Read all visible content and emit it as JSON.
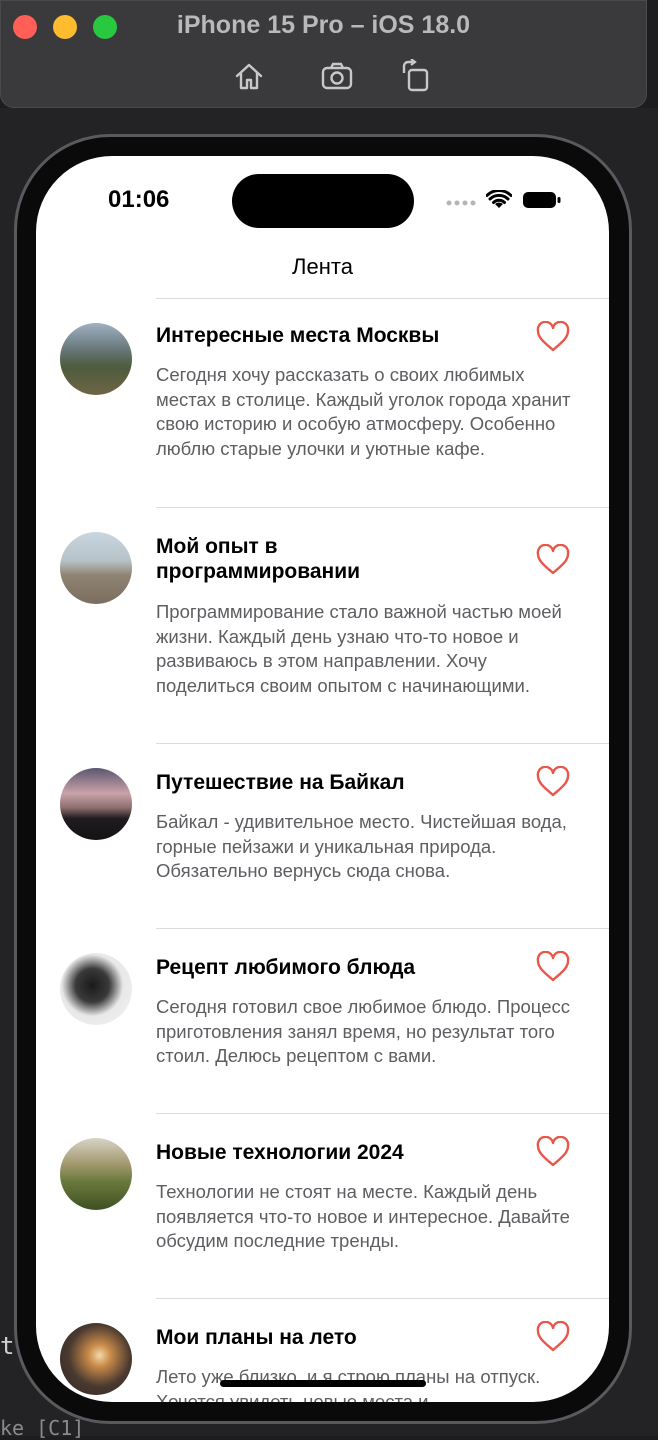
{
  "window": {
    "title": "iPhone 15 Pro – iOS 18.0"
  },
  "toolbar": {
    "icons": [
      "home-icon",
      "screenshot-icon",
      "rotate-icon"
    ]
  },
  "editor": {
    "left_text": "t",
    "bottom_text": "ke [C1]"
  },
  "status_bar": {
    "time": "01:06"
  },
  "nav": {
    "title": "Лента"
  },
  "colors": {
    "heart": "#e8574a",
    "body_text": "#5e5e62"
  },
  "posts": [
    {
      "title": "Интересные места Москвы",
      "body": "Сегодня хочу рассказать о своих любимых местах в столице. Каждый уголок города хранит свою историю и особую атмосферу. Особенно люблю старые улочки и уютные кафе."
    },
    {
      "title": "Мой опыт в программировании",
      "body": "Программирование стало важной частью моей жизни. Каждый день узнаю что-то новое и развиваюсь в этом направлении. Хочу поделиться своим опытом с начинающими."
    },
    {
      "title": "Путешествие на Байкал",
      "body": "Байкал - удивительное место. Чистейшая вода, горные пейзажи и уникальная природа. Обязательно вернусь сюда снова."
    },
    {
      "title": "Рецепт любимого блюда",
      "body": "Сегодня готовил свое любимое блюдо. Процесс приготовления занял время, но результат того стоил. Делюсь рецептом с вами."
    },
    {
      "title": "Новые технологии 2024",
      "body": "Технологии не стоят на месте. Каждый день появляется что-то новое и интересное. Давайте обсудим последние тренды."
    },
    {
      "title": "Мои планы на лето",
      "body": "Лето уже близко, и я строю планы на отпуск. Хочется увидеть новые места и"
    }
  ]
}
